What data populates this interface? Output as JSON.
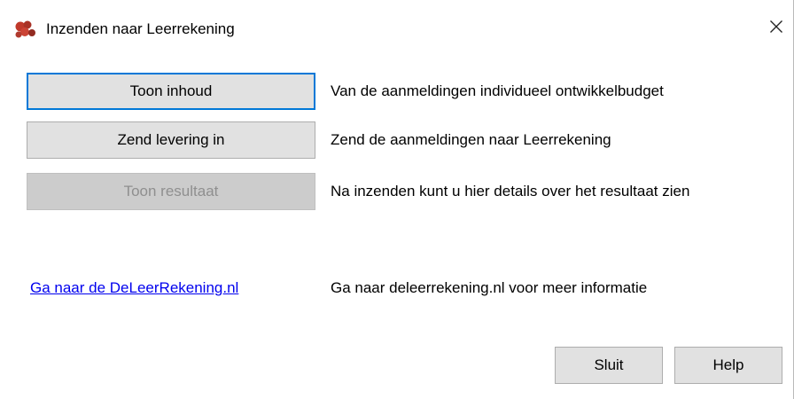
{
  "window": {
    "title": "Inzenden naar Leerrekening",
    "close_icon": "close-icon",
    "app_icon": "leerrekening-app-icon",
    "accent_color": "#0078d7"
  },
  "actions": [
    {
      "label": "Toon inhoud",
      "description": "Van de aanmeldingen individueel ontwikkelbudget",
      "enabled": true,
      "focused": true
    },
    {
      "label": "Zend levering in",
      "description": "Zend de aanmeldingen naar Leerrekening",
      "enabled": true,
      "focused": false
    },
    {
      "label": "Toon resultaat",
      "description": "Na inzenden kunt u hier details over het resultaat zien",
      "enabled": false,
      "focused": false
    }
  ],
  "link": {
    "label": "Ga naar de DeLeerRekening.nl",
    "description": "Ga naar deleerrekening.nl voor meer informatie"
  },
  "footer": {
    "close_label": "Sluit",
    "help_label": "Help"
  }
}
